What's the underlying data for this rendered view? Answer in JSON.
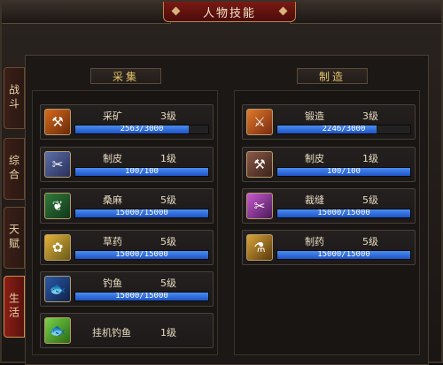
{
  "window": {
    "title": "人物技能"
  },
  "side_tabs": [
    {
      "label": "战斗",
      "active": false
    },
    {
      "label": "综合",
      "active": false
    },
    {
      "label": "天赋",
      "active": false
    },
    {
      "label": "生活",
      "active": true
    }
  ],
  "gathering": {
    "header": "采集",
    "skills": [
      {
        "name": "采矿",
        "level": "3级",
        "progress_text": "2563/3000",
        "progress": 0.854,
        "icon": "pickaxe-icon"
      },
      {
        "name": "制皮",
        "level": "1级",
        "progress_text": "100/100",
        "progress": 1.0,
        "icon": "skinning-icon"
      },
      {
        "name": "桑麻",
        "level": "5级",
        "progress_text": "15000/15000",
        "progress": 1.0,
        "icon": "hemp-icon"
      },
      {
        "name": "草药",
        "level": "5级",
        "progress_text": "15000/15000",
        "progress": 1.0,
        "icon": "herb-icon"
      },
      {
        "name": "钓鱼",
        "level": "5级",
        "progress_text": "15000/15000",
        "progress": 1.0,
        "icon": "fishing-icon"
      },
      {
        "name": "挂机钓鱼",
        "level": "1级",
        "icon": "afk-fishing-icon"
      }
    ]
  },
  "crafting": {
    "header": "制造",
    "skills": [
      {
        "name": "锻造",
        "level": "3级",
        "progress_text": "2246/3000",
        "progress": 0.749,
        "icon": "forging-icon"
      },
      {
        "name": "制皮",
        "level": "1级",
        "progress_text": "100/100",
        "progress": 1.0,
        "icon": "leatherwork-icon"
      },
      {
        "name": "裁缝",
        "level": "5级",
        "progress_text": "15000/15000",
        "progress": 1.0,
        "icon": "tailoring-icon"
      },
      {
        "name": "制药",
        "level": "5级",
        "progress_text": "15000/15000",
        "progress": 1.0,
        "icon": "alchemy-icon"
      }
    ]
  }
}
